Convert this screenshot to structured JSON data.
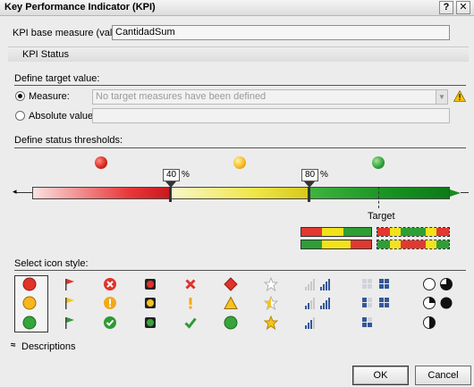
{
  "window": {
    "title": "Key Performance Indicator (KPI)",
    "help_label": "?",
    "close_label": "✕"
  },
  "base_measure": {
    "label": "KPI base measure (value):",
    "value": "CantidadSum"
  },
  "tab": {
    "label": "KPI Status"
  },
  "target": {
    "section_label": "Define target value:",
    "measure_label": "Measure:",
    "measure_placeholder": "No target measures have been defined",
    "measure_selected": true,
    "absolute_label": "Absolute value:",
    "absolute_value": "",
    "warning_icon": "warning-icon"
  },
  "thresholds": {
    "section_label": "Define status thresholds:",
    "low_pct": "40",
    "high_pct": "80",
    "pct_symbol": "%",
    "target_label": "Target",
    "colors": {
      "red": "#e2382f",
      "yellow": "#f2d21a",
      "green": "#2e9e35"
    }
  },
  "icon_style": {
    "section_label": "Select icon style:",
    "selected_index": 0,
    "styles": [
      "traffic-lights",
      "flags",
      "circled-symbols",
      "square-lights",
      "symbols",
      "shapes",
      "stars",
      "signal-bars",
      "boxes",
      "pie-circles"
    ]
  },
  "descriptions": {
    "label": "Descriptions",
    "expand_icon": "double-chevron-up-icon"
  },
  "buttons": {
    "ok": "OK",
    "cancel": "Cancel"
  }
}
